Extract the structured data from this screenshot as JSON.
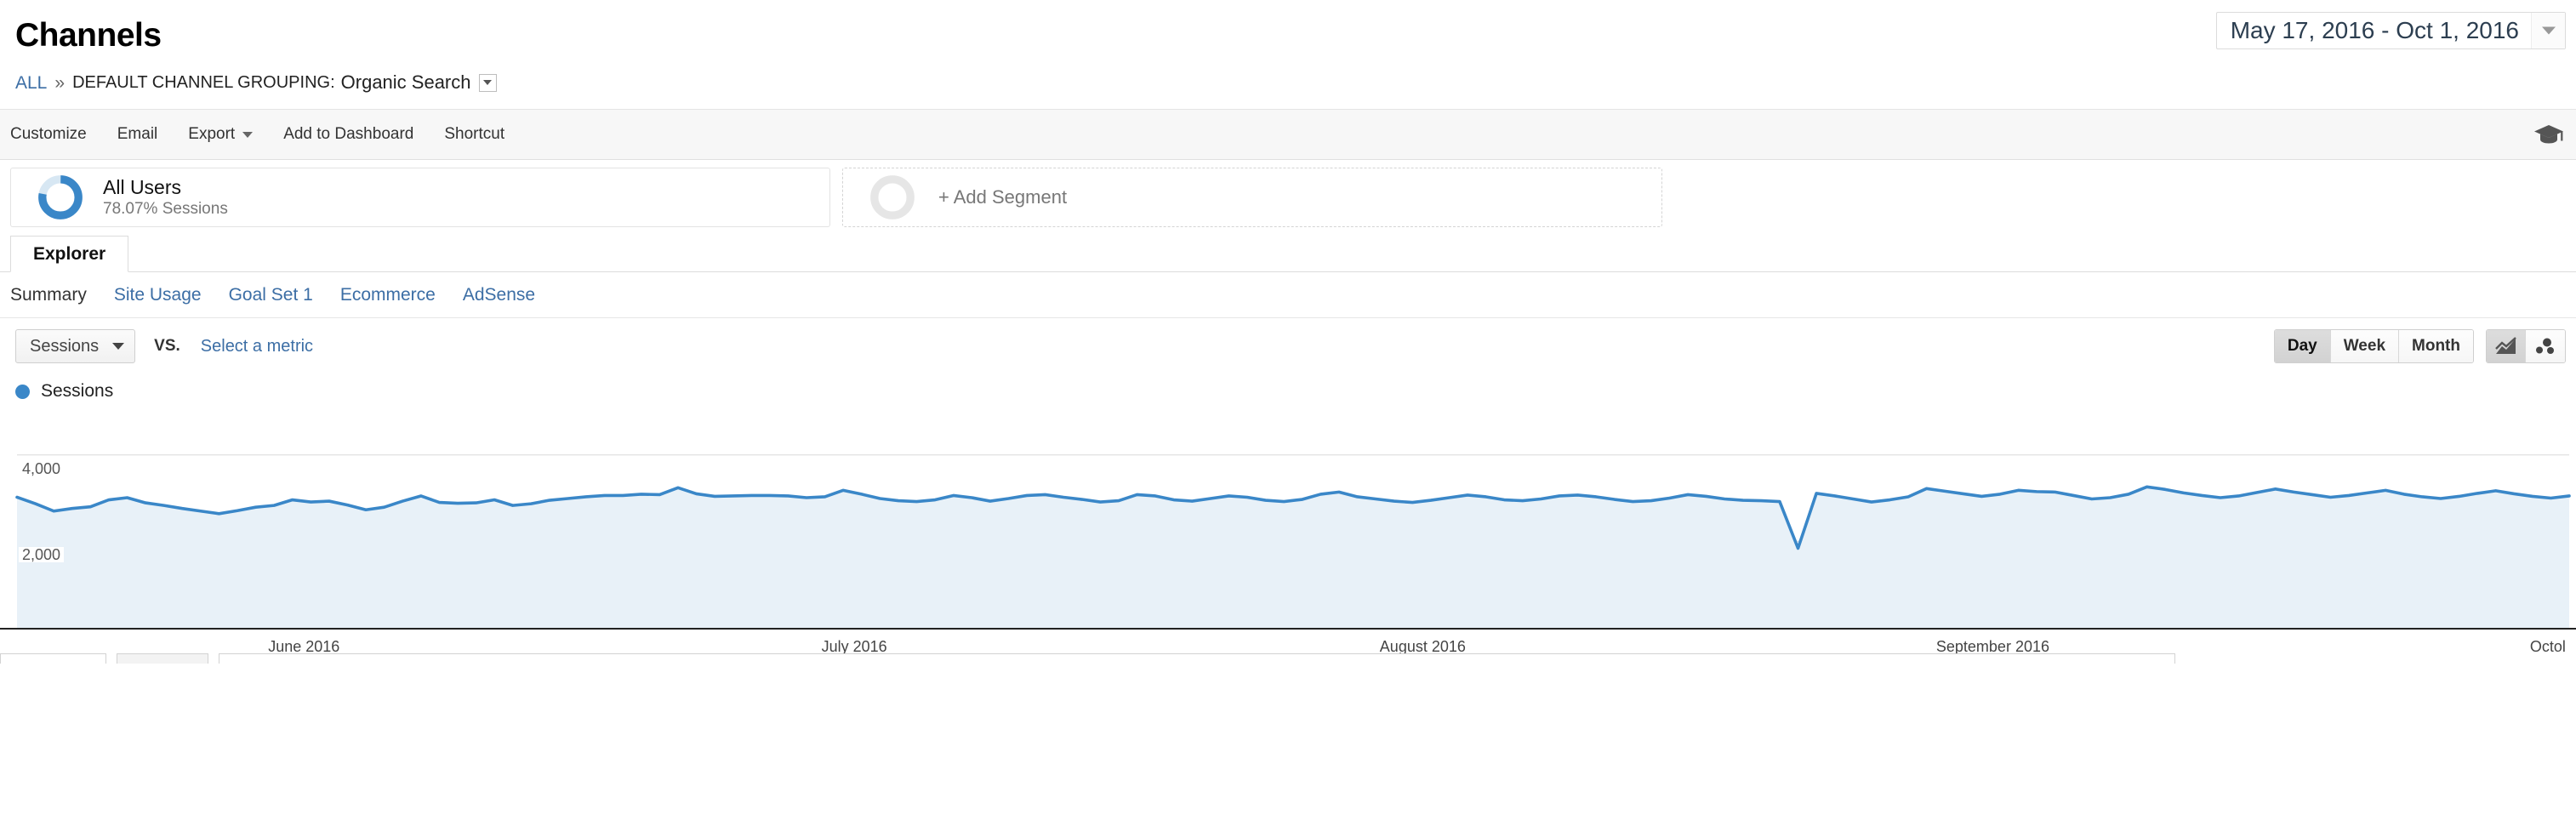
{
  "header": {
    "title": "Channels",
    "breadcrumb": {
      "all": "ALL",
      "separator": "»",
      "dimension_label": "DEFAULT CHANNEL GROUPING:",
      "dimension_value": "Organic Search"
    },
    "date_range": "May 17, 2016 - Oct 1, 2016"
  },
  "toolbar": {
    "customize": "Customize",
    "email": "Email",
    "export": "Export",
    "add_to_dashboard": "Add to Dashboard",
    "shortcut": "Shortcut",
    "academy_icon": "graduation-cap-icon"
  },
  "segments": {
    "all_users": {
      "title": "All Users",
      "sessions_pct": "78.07% Sessions",
      "donut_value": 78.07,
      "donut_color": "#3a87c8",
      "donut_track": "#d7e7f3"
    },
    "add_segment": {
      "label": "+ Add Segment"
    }
  },
  "tabs": {
    "explorer": "Explorer"
  },
  "subnav": {
    "items": [
      {
        "label": "Summary",
        "active": true
      },
      {
        "label": "Site Usage",
        "active": false
      },
      {
        "label": "Goal Set 1",
        "active": false
      },
      {
        "label": "Ecommerce",
        "active": false
      },
      {
        "label": "AdSense",
        "active": false
      }
    ]
  },
  "metric_row": {
    "primary_metric": "Sessions",
    "vs_label": "VS.",
    "secondary_metric_placeholder": "Select a metric",
    "granularity": [
      {
        "label": "Day",
        "selected": true
      },
      {
        "label": "Week",
        "selected": false
      },
      {
        "label": "Month",
        "selected": false
      }
    ],
    "chart_types": [
      {
        "icon": "line-chart-icon",
        "selected": true
      },
      {
        "icon": "scatter-plot-icon",
        "selected": false
      }
    ]
  },
  "legend": {
    "series_label": "Sessions",
    "series_color": "#3a87c8"
  },
  "chart_data": {
    "type": "line",
    "title": "Sessions",
    "xlabel": "",
    "ylabel": "Sessions",
    "ylim": [
      0,
      4800
    ],
    "yticks": [
      2000,
      4000
    ],
    "ytick_labels": [
      "2,000",
      "4,000"
    ],
    "grid": true,
    "legend_position": "top-left",
    "area_fill": true,
    "area_fill_color": "#e8f1f8",
    "line_color": "#3a87c8",
    "x_tick_labels": [
      "June 2016",
      "July 2016",
      "August 2016",
      "September 2016",
      "Octol"
    ],
    "series": [
      {
        "name": "Sessions",
        "values": [
          3020,
          2870,
          2700,
          2760,
          2800,
          2960,
          3010,
          2890,
          2830,
          2760,
          2700,
          2640,
          2710,
          2790,
          2830,
          2960,
          2910,
          2930,
          2840,
          2730,
          2790,
          2930,
          3050,
          2900,
          2880,
          2890,
          2960,
          2830,
          2870,
          2950,
          2990,
          3030,
          3060,
          3060,
          3090,
          3080,
          3240,
          3100,
          3040,
          3050,
          3060,
          3060,
          3050,
          3010,
          3030,
          3180,
          3090,
          2990,
          2940,
          2920,
          2960,
          3060,
          3010,
          2930,
          2990,
          3060,
          3080,
          3020,
          2970,
          2910,
          2940,
          3080,
          3050,
          2960,
          2930,
          2990,
          3050,
          3020,
          2950,
          2920,
          2970,
          3090,
          3140,
          3030,
          2980,
          2930,
          2900,
          2950,
          3010,
          3070,
          3030,
          2960,
          2940,
          2980,
          3050,
          3070,
          3030,
          2970,
          2920,
          2940,
          3000,
          3080,
          3040,
          2980,
          2950,
          2940,
          2920,
          1840,
          3110,
          3050,
          2980,
          2910,
          2960,
          3030,
          3220,
          3160,
          3100,
          3040,
          3090,
          3180,
          3150,
          3140,
          3060,
          2980,
          3010,
          3090,
          3260,
          3200,
          3120,
          3060,
          3010,
          3050,
          3130,
          3210,
          3140,
          3080,
          3020,
          3060,
          3120,
          3180,
          3090,
          3030,
          2990,
          3040,
          3110,
          3170,
          3100,
          3040,
          3000,
          3050
        ]
      }
    ]
  }
}
